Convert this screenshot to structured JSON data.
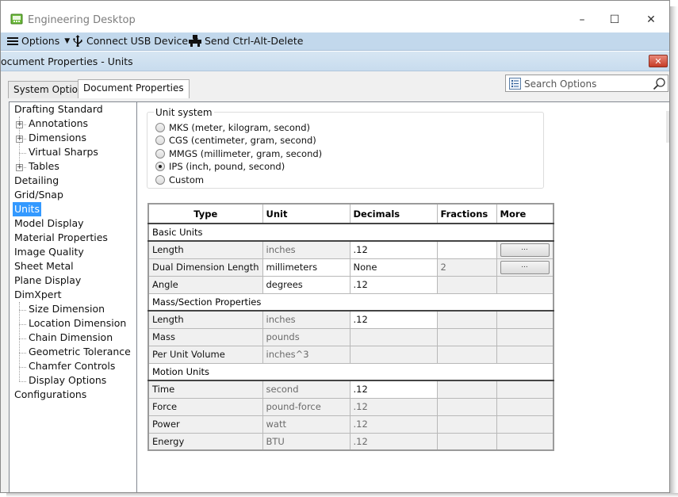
{
  "app": {
    "title": "Engineering Desktop",
    "controls": {
      "minimize": "–",
      "maximize": "☐",
      "close": "✕"
    }
  },
  "toolbar": {
    "options_label": "Options",
    "usb_label": "Connect USB Device",
    "cad_label": "Send Ctrl-Alt-Delete"
  },
  "dialog": {
    "title": "ocument Properties - Units",
    "close_label": "✕",
    "tabs": [
      "System Options",
      "Document Properties"
    ],
    "search_placeholder": "Search Options"
  },
  "tree": [
    {
      "label": "Drafting Standard",
      "level": 0
    },
    {
      "label": "Annotations",
      "level": 1,
      "expandable": true
    },
    {
      "label": "Dimensions",
      "level": 1,
      "expandable": true
    },
    {
      "label": "Virtual Sharps",
      "level": 1
    },
    {
      "label": "Tables",
      "level": 1,
      "expandable": true
    },
    {
      "label": "Detailing",
      "level": 0
    },
    {
      "label": "Grid/Snap",
      "level": 0
    },
    {
      "label": "Units",
      "level": 0,
      "selected": true
    },
    {
      "label": "Model Display",
      "level": 0
    },
    {
      "label": "Material Properties",
      "level": 0
    },
    {
      "label": "Image Quality",
      "level": 0
    },
    {
      "label": "Sheet Metal",
      "level": 0
    },
    {
      "label": "Plane Display",
      "level": 0
    },
    {
      "label": "DimXpert",
      "level": 0
    },
    {
      "label": "Size Dimension",
      "level": 1
    },
    {
      "label": "Location Dimension",
      "level": 1
    },
    {
      "label": "Chain Dimension",
      "level": 1
    },
    {
      "label": "Geometric Tolerance",
      "level": 1
    },
    {
      "label": "Chamfer Controls",
      "level": 1
    },
    {
      "label": "Display Options",
      "level": 1
    },
    {
      "label": "Configurations",
      "level": 0
    }
  ],
  "unit_system": {
    "label": "Unit system",
    "options": [
      {
        "label": "MKS  (meter, kilogram, second)",
        "checked": false
      },
      {
        "label": "CGS  (centimeter, gram, second)",
        "checked": false
      },
      {
        "label": "MMGS (millimeter, gram, second)",
        "checked": false
      },
      {
        "label": "IPS  (inch, pound, second)",
        "checked": true
      },
      {
        "label": "Custom",
        "checked": false
      }
    ]
  },
  "units_table": {
    "headers": [
      "Type",
      "Unit",
      "Decimals",
      "Fractions",
      "More"
    ],
    "more_button": "...",
    "sections": [
      {
        "title": "Basic Units",
        "rows": [
          {
            "type": "Length",
            "unit": "inches",
            "decimals": ".12",
            "fractions": "",
            "more": true
          },
          {
            "type": "Dual Dimension Length",
            "unit": "millimeters",
            "decimals": "None",
            "fractions": "2",
            "more": true
          },
          {
            "type": "Angle",
            "unit": "degrees",
            "decimals": ".12",
            "fractions": "",
            "more": false
          }
        ]
      },
      {
        "title": "Mass/Section Properties",
        "rows": [
          {
            "type": "Length",
            "unit": "inches",
            "decimals": ".12",
            "fractions": "",
            "more": false
          },
          {
            "type": "Mass",
            "unit": "pounds",
            "decimals": "",
            "fractions": "",
            "more": false
          },
          {
            "type": "Per Unit Volume",
            "unit": "inches^3",
            "decimals": "",
            "fractions": "",
            "more": false
          }
        ]
      },
      {
        "title": "Motion Units",
        "rows": [
          {
            "type": "Time",
            "unit": "second",
            "decimals": ".12",
            "fractions": "",
            "more": false
          },
          {
            "type": "Force",
            "unit": "pound-force",
            "decimals": ".12",
            "fractions": "",
            "more": false
          },
          {
            "type": "Power",
            "unit": "watt",
            "decimals": ".12",
            "fractions": "",
            "more": false
          },
          {
            "type": "Energy",
            "unit": "BTU",
            "decimals": ".12",
            "fractions": "",
            "more": false
          }
        ]
      }
    ]
  }
}
